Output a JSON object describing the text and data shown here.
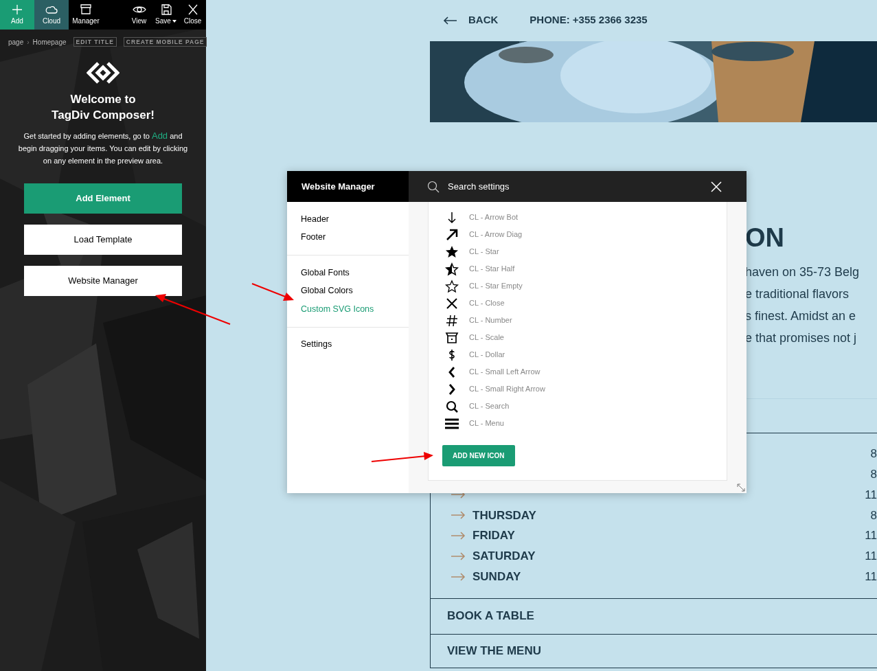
{
  "toolbar": {
    "buttons": [
      {
        "kind": "add",
        "label": "Add",
        "color": "#1a9c74"
      },
      {
        "kind": "cloud",
        "label": "Cloud",
        "color": "#2b5f63"
      },
      {
        "kind": "manager",
        "label": "Manager"
      },
      {
        "kind": "view",
        "label": "View"
      },
      {
        "kind": "save",
        "label": "Save",
        "has_menu": true
      },
      {
        "kind": "close",
        "label": "Close"
      }
    ]
  },
  "breadcrumb": {
    "items": [
      "page",
      "Homepage"
    ],
    "separator": "›",
    "actions": [
      "EDIT TITLE",
      "CREATE MOBILE PAGE"
    ]
  },
  "welcome": {
    "title_lines": [
      "Welcome to",
      "TagDiv Composer!"
    ],
    "text_before": "Get started by adding elements, go to ",
    "link": "Add",
    "text_after": " and begin dragging your items. You can edit by clicking on any element in the preview area."
  },
  "sidebar_buttons": [
    {
      "kind": "primary",
      "label": "Add Element"
    },
    {
      "kind": "secondary",
      "label": "Load Template"
    },
    {
      "kind": "secondary",
      "label": "Website Manager"
    }
  ],
  "preview": {
    "back": "BACK",
    "phone": "PHONE: +355 2366 3235",
    "heading": "ON",
    "paragraph_lines": [
      "haven on 35-73 Belg",
      "e traditional flavors",
      "s finest. Amidst an e",
      "e that promises not j"
    ],
    "hours": [
      {
        "kind": "covered",
        "time": "8"
      },
      {
        "kind": "covered",
        "time": "8"
      },
      {
        "kind": "day",
        "time": "11"
      },
      {
        "kind": "day",
        "day": "THURSDAY",
        "time": "8"
      },
      {
        "kind": "day",
        "day": "FRIDAY",
        "time": "11"
      },
      {
        "kind": "day",
        "day": "SATURDAY",
        "time": "11"
      },
      {
        "kind": "day",
        "day": "SUNDAY",
        "time": "11"
      }
    ],
    "links": [
      "BOOK A TABLE",
      "VIEW THE MENU"
    ]
  },
  "modal": {
    "title": "Website Manager",
    "search": {
      "placeholder": "Search settings"
    },
    "nav_groups": [
      [
        {
          "label": "Header",
          "selected": false
        },
        {
          "label": "Footer",
          "selected": false
        }
      ],
      [
        {
          "label": "Global Fonts",
          "selected": false
        },
        {
          "label": "Global Colors",
          "selected": false
        },
        {
          "label": "Custom SVG Icons",
          "selected": true
        }
      ],
      [
        {
          "label": "Settings",
          "selected": false
        }
      ]
    ],
    "icons": [
      {
        "kind": "arrow-down",
        "label": "CL - Arrow Bot"
      },
      {
        "kind": "arrow-diag",
        "label": "CL - Arrow Diag"
      },
      {
        "kind": "star",
        "label": "CL - Star"
      },
      {
        "kind": "star-half",
        "label": "CL - Star Half"
      },
      {
        "kind": "star-empty",
        "label": "CL - Star Empty"
      },
      {
        "kind": "close",
        "label": "CL - Close"
      },
      {
        "kind": "hash",
        "label": "CL - Number"
      },
      {
        "kind": "scale",
        "label": "CL - Scale"
      },
      {
        "kind": "dollar",
        "label": "CL - Dollar"
      },
      {
        "kind": "chevron-left",
        "label": "CL - Small Left Arrow"
      },
      {
        "kind": "chevron-right",
        "label": "CL - Small Right Arrow"
      },
      {
        "kind": "search",
        "label": "CL - Search"
      },
      {
        "kind": "menu",
        "label": "CL - Menu"
      }
    ],
    "add_button": "ADD NEW ICON"
  }
}
